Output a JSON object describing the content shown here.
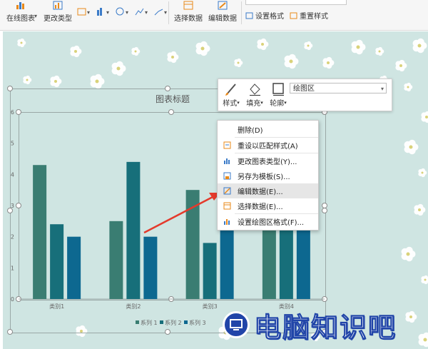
{
  "ribbon": {
    "online_chart_label": "在线图表",
    "change_type_label": "更改类型",
    "select_data_label": "选择数据",
    "edit_data_label": "编辑数据",
    "set_format_label": "设置格式",
    "reset_style_label": "重置样式"
  },
  "mini_toolbar": {
    "style_label": "样式",
    "fill_label": "填充",
    "outline_label": "轮廓",
    "element_select_value": "绘图区"
  },
  "context_menu": {
    "items": [
      {
        "label": "删除(D)",
        "icon": "none"
      },
      {
        "label": "重设以匹配样式(A)",
        "icon": "reset-style-icon"
      },
      {
        "label": "更改图表类型(Y)...",
        "icon": "chart-type-icon"
      },
      {
        "label": "另存为模板(S)...",
        "icon": "save-template-icon"
      },
      {
        "label": "编辑数据(E)...",
        "icon": "edit-data-icon",
        "highlighted": true
      },
      {
        "label": "选择数据(E)...",
        "icon": "select-data-icon"
      },
      {
        "label": "设置绘图区格式(F)...",
        "icon": "format-plot-area-icon"
      }
    ]
  },
  "chart_data": {
    "type": "bar",
    "title": "图表标题",
    "categories": [
      "类别1",
      "类别2",
      "类别3",
      "类别4"
    ],
    "series": [
      {
        "name": "系列 1",
        "values": [
          4.3,
          2.5,
          3.5,
          4.5
        ],
        "color": "#3a7d72"
      },
      {
        "name": "系列 2",
        "values": [
          2.4,
          4.4,
          1.8,
          2.8
        ],
        "color": "#176f7a"
      },
      {
        "name": "系列 3",
        "values": [
          2.0,
          2.0,
          3.0,
          5.0
        ],
        "color": "#0d6890"
      }
    ],
    "ylim": [
      0,
      6
    ],
    "yticks": [
      "0",
      "1",
      "2",
      "3",
      "4",
      "5",
      "6"
    ],
    "legend_position": "bottom",
    "grid": false
  },
  "watermark": {
    "text": "电脑知识吧"
  },
  "colors": {
    "slide_background": "#cfe5e2",
    "menu_highlight": "#e6e6e6",
    "arrow": "#e43a2c",
    "watermark_blue": "#2145a8"
  }
}
